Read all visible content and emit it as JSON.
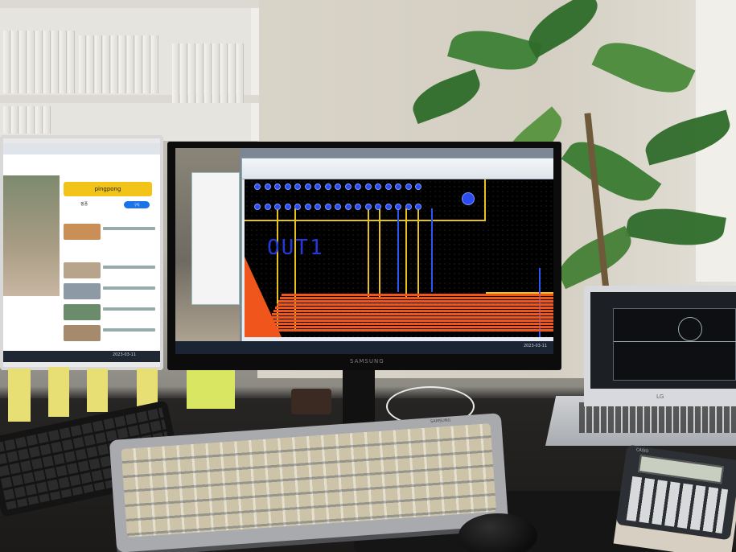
{
  "left_monitor": {
    "banner_text": "pingpong",
    "channel_name": "핑퐁",
    "subscribe_label": "구독",
    "clock_text": "2023-03-11"
  },
  "center_monitor": {
    "pcb_silkscreen_label": "OUT1",
    "taskbar_clock": "2023-03-11",
    "brand": "SAMSUNG"
  },
  "laptop": {
    "brand": "LG"
  },
  "keyboard": {
    "brand": "SAMSUNG"
  },
  "calculator": {
    "brand": "CASIO"
  }
}
